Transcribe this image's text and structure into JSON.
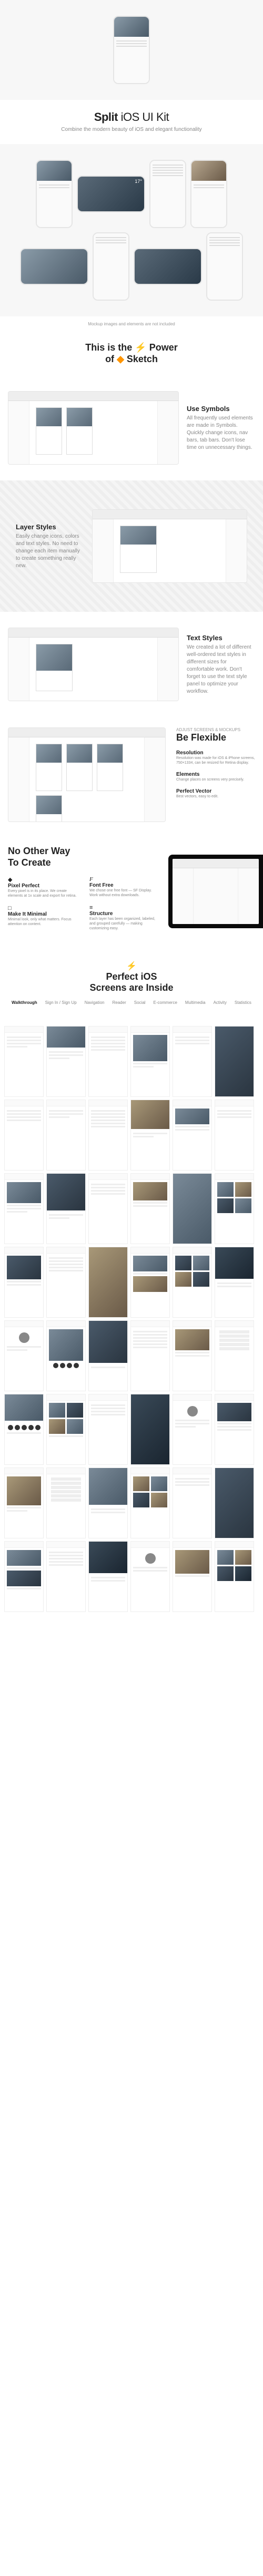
{
  "hero": {
    "title_bold": "Split",
    "title_light": " iOS UI Kit",
    "subtitle": "Combine the modern beauty of iOS and elegant functionality",
    "temperature": "17°"
  },
  "mockup_note": "Mockup images and elements are not included",
  "sketch": {
    "heading_pre": "This is the ",
    "heading_post": " Power",
    "heading_of": "of ",
    "heading_app": " Sketch",
    "symbols": {
      "title": "Use Symbols",
      "desc": "All frequently used elements are made in Symbols. Quickly change icons, nav bars, tab bars. Don't lose time on unnecessary things."
    },
    "layers": {
      "title": "Layer Styles",
      "desc": "Easily change icons, colors and text styles. No need to change each item manually to create something really new."
    },
    "textstyles": {
      "title": "Text Styles",
      "desc": "We created a lot of different well-ordered text styles in different sizes for comfortable work. Don't forget to use the text style panel to optimize your workflow."
    }
  },
  "flexible": {
    "kicker": "ADJUST SCREENS & MOCKUPS",
    "title": "Be Flexible",
    "items": [
      {
        "name": "Resolution",
        "desc": "Resolution was made for iOS & iPhone screens, 750×1334, can be resized for Retina display."
      },
      {
        "name": "Elements",
        "desc": "Change places on screens very precisely."
      },
      {
        "name": "Perfect Vector",
        "desc": "Best vectors, easy to edit."
      }
    ]
  },
  "create": {
    "title_l1": "No Other Way",
    "title_l2": "To Create",
    "items": [
      {
        "icon": "◆",
        "name": "Pixel Perfect",
        "desc": "Every pixel is in its place. We create elements at 1x scale and export for retina."
      },
      {
        "icon": "F",
        "name": "Font Free",
        "desc": "We chose one free font — SF Display. Work without extra downloads."
      },
      {
        "icon": "□",
        "name": "Make It Minimal",
        "desc": "Minimal look, only what matters. Focus attention on content."
      },
      {
        "icon": "≡",
        "name": "Structure",
        "desc": "Each layer has been organized, labeled, and grouped carefully — making customizing easy."
      }
    ]
  },
  "screens": {
    "title_pre": "Perfect ",
    "title_mid": "iOS",
    "title_l2_pre": "Screens",
    "title_l2_post": " are Inside",
    "categories": [
      "Walkthrough",
      "Sign In / Sign Up",
      "Navigation",
      "Reader",
      "Social",
      "E-commerce",
      "Multimedia",
      "Activity",
      "Statistics"
    ]
  }
}
